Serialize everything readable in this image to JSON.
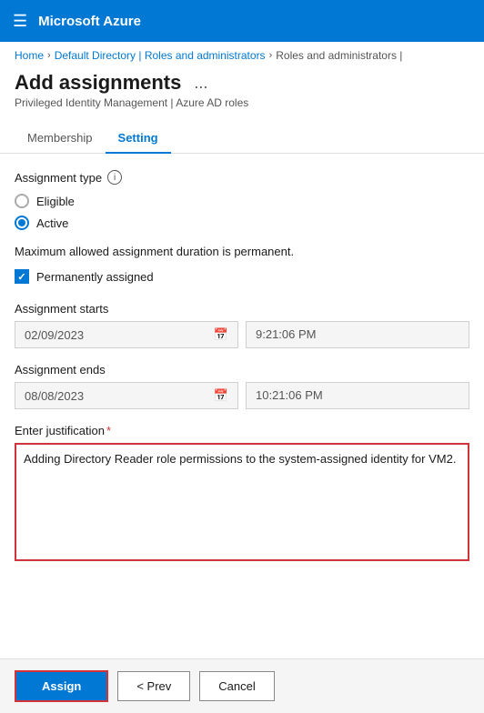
{
  "topbar": {
    "title": "Microsoft Azure",
    "hamburger_label": "☰"
  },
  "breadcrumb": {
    "items": [
      {
        "label": "Home",
        "link": true
      },
      {
        "label": "Default Directory | Roles and administrators",
        "link": true
      },
      {
        "label": "Roles and administrators |",
        "link": false
      }
    ],
    "separator": "›"
  },
  "page": {
    "title": "Add assignments",
    "ellipsis": "...",
    "subtitle": "Privileged Identity Management | Azure AD roles"
  },
  "tabs": [
    {
      "label": "Membership",
      "active": false
    },
    {
      "label": "Setting",
      "active": true
    }
  ],
  "assignment_type": {
    "label": "Assignment type",
    "options": [
      {
        "label": "Eligible",
        "checked": false
      },
      {
        "label": "Active",
        "checked": true
      }
    ]
  },
  "notice": {
    "text": "Maximum allowed assignment duration is permanent."
  },
  "checkbox": {
    "label": "Permanently assigned",
    "checked": true
  },
  "assignment_starts": {
    "label": "Assignment starts",
    "date": "02/09/2023",
    "time": "9:21:06 PM"
  },
  "assignment_ends": {
    "label": "Assignment ends",
    "date": "08/08/2023",
    "time": "10:21:06 PM"
  },
  "justification": {
    "label": "Enter justification",
    "required_mark": "*",
    "value": "Adding Directory Reader role permissions to the system-assigned identity for VM2."
  },
  "footer": {
    "assign_label": "Assign",
    "prev_label": "< Prev",
    "cancel_label": "Cancel"
  }
}
